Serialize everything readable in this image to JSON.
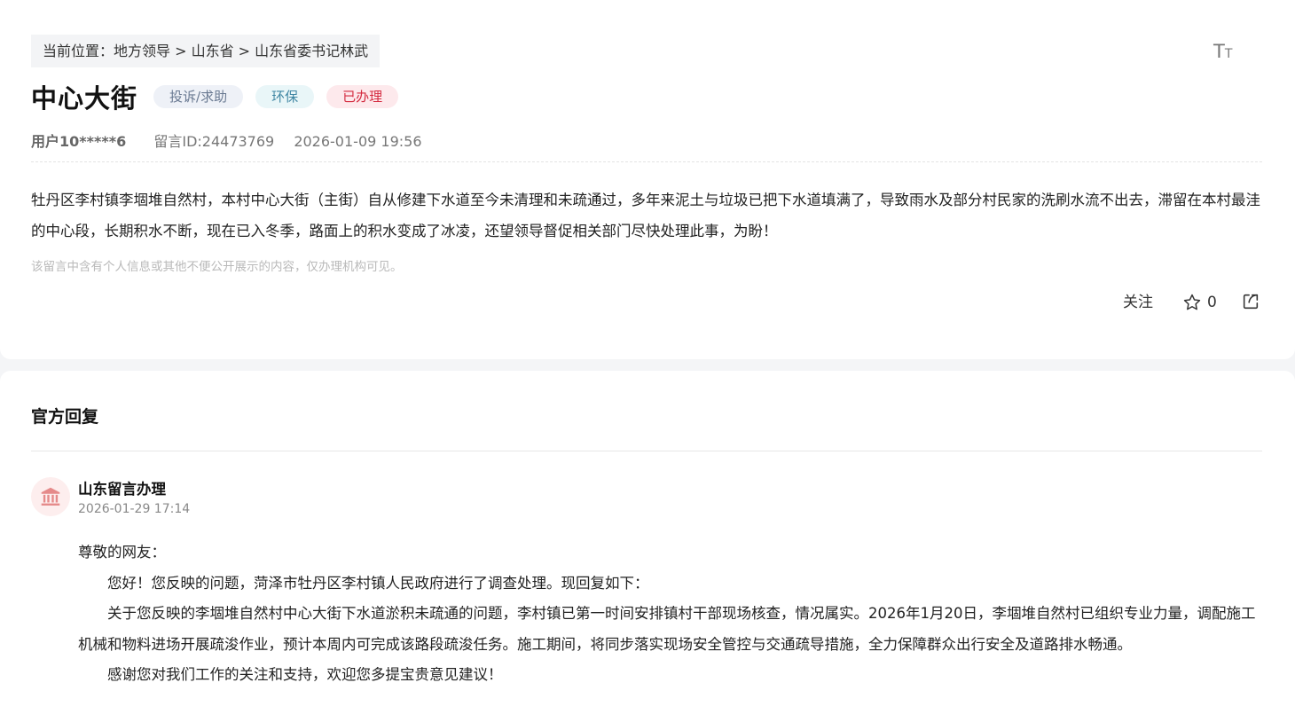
{
  "breadcrumb": {
    "text": "当前位置：地方领导 > 山东省 > 山东省委书记林武"
  },
  "font_size_icon": "font-size-icon",
  "post": {
    "title": "中心大街",
    "tags": {
      "category": "投诉/求助",
      "topic": "环保",
      "status": "已办理"
    },
    "user": "用户10*****6",
    "message_id": "留言ID:24473769",
    "datetime": "2026-01-09 19:56",
    "content": "牡丹区李村镇李堌堆自然村，本村中心大街（主街）自从修建下水道至今未清理和未疏通过，多年来泥土与垃圾已把下水道填满了，导致雨水及部分村民家的洗刷水流不出去，滞留在本村最洼的中心段，长期积水不断，现在已入冬季，路面上的积水变成了冰凌，还望领导督促相关部门尽快处理此事，为盼！",
    "notice": "该留言中含有个人信息或其他不便公开展示的内容，仅办理机构可见。"
  },
  "actions": {
    "follow_label": "关注",
    "star_count": "0",
    "star_icon": "star-outline-icon",
    "share_icon": "share-icon"
  },
  "colors": {
    "tag_status": "#d42a3f",
    "tag_topic": "#3f86a3",
    "tag_category": "#6a7a92",
    "avatar_bg": "#fdeeee",
    "avatar_icon": "#e58a8a"
  },
  "official_reply": {
    "section_title": "官方回复",
    "org_icon": "government-building-icon",
    "org_name": "山东留言办理",
    "date": "2026-01-29 17:14",
    "greeting": "尊敬的网友：",
    "paragraphs": [
      "您好！您反映的问题，菏泽市牡丹区李村镇人民政府进行了调查处理。现回复如下：",
      "关于您反映的李堌堆自然村中心大街下水道淤积未疏通的问题，李村镇已第一时间安排镇村干部现场核查，情况属实。2026年1月20日，李堌堆自然村已组织专业力量，调配施工机械和物料进场开展疏浚作业，预计本周内可完成该路段疏浚任务。施工期间，将同步落实现场安全管控与交通疏导措施，全力保障群众出行安全及道路排水畅通。",
      "感谢您对我们工作的关注和支持，欢迎您多提宝贵意见建议！"
    ]
  }
}
